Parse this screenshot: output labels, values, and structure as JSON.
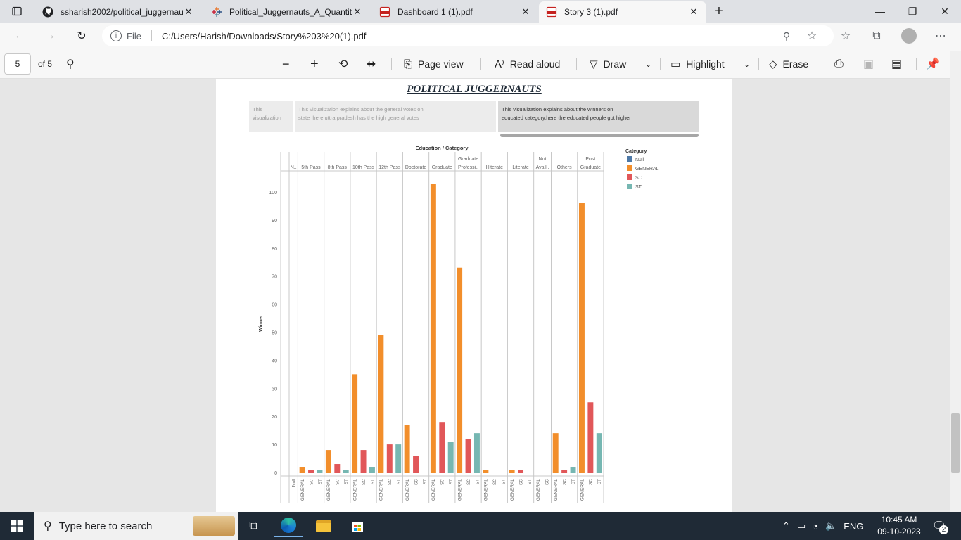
{
  "browser": {
    "tabs": [
      {
        "label": "ssharish2002/political_juggernau",
        "icon": "github-icon"
      },
      {
        "label": "Political_Juggernauts_A_Quantita",
        "icon": "tableau-icon"
      },
      {
        "label": "Dashboard 1 (1).pdf",
        "icon": "pdf-icon"
      },
      {
        "label": "Story 3 (1).pdf",
        "icon": "pdf-icon"
      }
    ],
    "address_scheme": "File",
    "address_url": "C:/Users/Harish/Downloads/Story%203%20(1).pdf"
  },
  "pdf_toolbar": {
    "page_number": "5",
    "page_total": "of 5",
    "page_view_label": "Page view",
    "read_aloud_label": "Read aloud",
    "draw_label": "Draw",
    "highlight_label": "Highlight",
    "erase_label": "Erase"
  },
  "story": {
    "title": "POLITICAL   JUGGERNAUTS",
    "points": [
      "This visualization ...",
      "This visualization explains about the general votes on state ,here uttra pradesh has the high general votes",
      "This visualization explains about the winners on educated category,here the educated people got higher posibilities"
    ]
  },
  "chart_data": {
    "type": "bar",
    "title": "Education / Category",
    "ylabel": "Winner",
    "ylim": [
      0,
      105
    ],
    "yticks": [
      0,
      10,
      20,
      30,
      40,
      50,
      60,
      70,
      80,
      90,
      100
    ],
    "legend_title": "Category",
    "legend_placement": "right",
    "grid": false,
    "legend": [
      {
        "name": "Null",
        "color": "#4e79a7"
      },
      {
        "name": "GENERAL",
        "color": "#f28e2b"
      },
      {
        "name": "SC",
        "color": "#e15759"
      },
      {
        "name": "ST",
        "color": "#76b7b2"
      }
    ],
    "panels": [
      {
        "label": "N..",
        "categories": [
          "Null"
        ],
        "values": [
          0
        ]
      },
      {
        "label": "5th Pass",
        "categories": [
          "GENERAL",
          "SC",
          "ST"
        ],
        "values": [
          2,
          1,
          1
        ]
      },
      {
        "label": "8th Pass",
        "categories": [
          "GENERAL",
          "SC",
          "ST"
        ],
        "values": [
          8,
          3,
          1
        ]
      },
      {
        "label": "10th Pass",
        "categories": [
          "GENERAL",
          "SC",
          "ST"
        ],
        "values": [
          35,
          8,
          2
        ]
      },
      {
        "label": "12th Pass",
        "categories": [
          "GENERAL",
          "SC",
          "ST"
        ],
        "values": [
          49,
          10,
          10
        ]
      },
      {
        "label": "Doctorate",
        "categories": [
          "GENERAL",
          "SC",
          "ST"
        ],
        "values": [
          17,
          6,
          0
        ]
      },
      {
        "label": "Graduate",
        "categories": [
          "GENERAL",
          "SC",
          "ST"
        ],
        "values": [
          103,
          18,
          11
        ]
      },
      {
        "label": "Graduate Professi..",
        "categories": [
          "GENERAL",
          "SC",
          "ST"
        ],
        "values": [
          73,
          12,
          14
        ]
      },
      {
        "label": "Illiterate",
        "categories": [
          "GENERAL",
          "SC",
          "ST"
        ],
        "values": [
          1,
          0,
          0
        ]
      },
      {
        "label": "Literate",
        "categories": [
          "GENERAL",
          "SC",
          "ST"
        ],
        "values": [
          1,
          1,
          0
        ]
      },
      {
        "label": "Not Avail..",
        "categories": [
          "GENERAL",
          "SC"
        ],
        "values": [
          0,
          0
        ]
      },
      {
        "label": "Others",
        "categories": [
          "GENERAL",
          "SC",
          "ST"
        ],
        "values": [
          14,
          1,
          2
        ]
      },
      {
        "label": "Post Graduate",
        "categories": [
          "GENERAL",
          "SC",
          "ST"
        ],
        "values": [
          96,
          25,
          14
        ]
      }
    ]
  },
  "taskbar": {
    "search_placeholder": "Type here to search",
    "language": "ENG",
    "time": "10:45 AM",
    "date": "09-10-2023",
    "notification_count": "2"
  }
}
